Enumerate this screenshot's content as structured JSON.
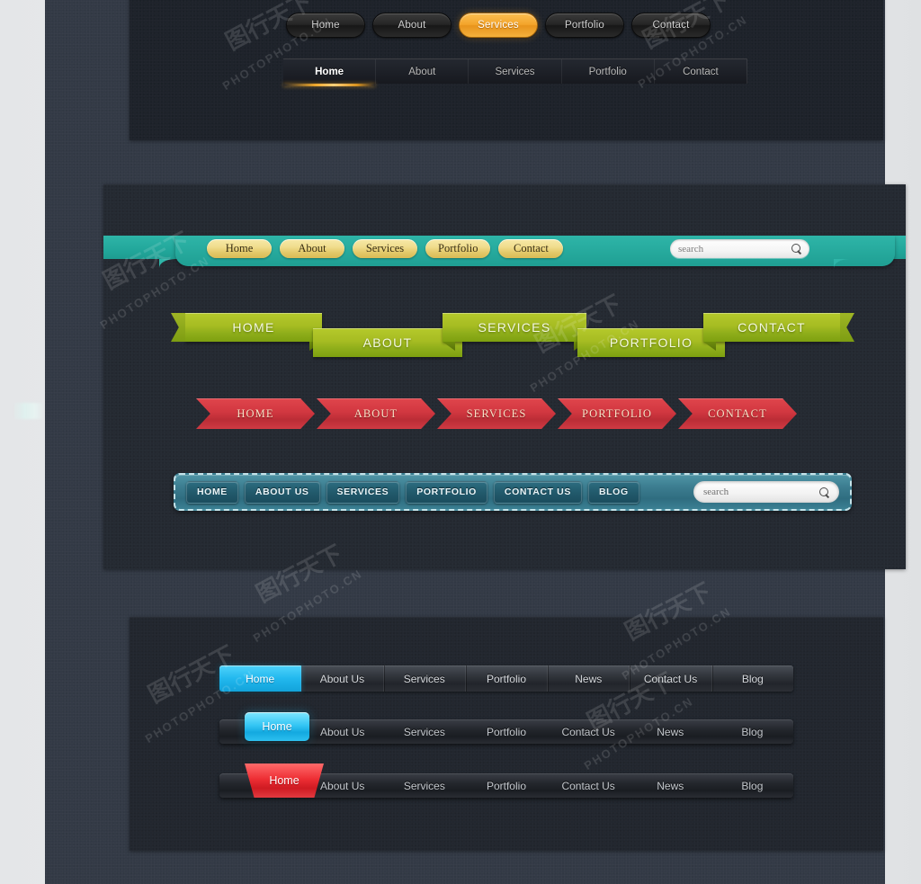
{
  "page": {
    "title": "Web Navigation Menu UI Kit",
    "background_color": "#e8eaec",
    "stage_color": "#333a46",
    "panel_color": "#1e232b"
  },
  "watermark": {
    "text": "PHOTOPHOTO.CN",
    "short": "PHOTO.CN",
    "cn": "图行天下"
  },
  "navs": {
    "pills": {
      "name": "glossy-pill-nav",
      "accent": "#f3a42a",
      "items": [
        {
          "label": "Home",
          "active": false
        },
        {
          "label": "About",
          "active": false
        },
        {
          "label": "Services",
          "active": true
        },
        {
          "label": "Portfolio",
          "active": false
        },
        {
          "label": "Contact",
          "active": false
        }
      ]
    },
    "tabs": {
      "name": "flat-underline-tab-nav",
      "accent": "#f0a82c",
      "items": [
        {
          "label": "Home",
          "active": true
        },
        {
          "label": "About",
          "active": false
        },
        {
          "label": "Services",
          "active": false
        },
        {
          "label": "Portfolio",
          "active": false
        },
        {
          "label": "Contact",
          "active": false
        }
      ]
    },
    "teal": {
      "name": "teal-banner-nav",
      "band_color": "#22a79b",
      "pill_color": "#e8d77f",
      "items": [
        {
          "label": "Home"
        },
        {
          "label": "About"
        },
        {
          "label": "Services"
        },
        {
          "label": "Portfolio"
        },
        {
          "label": "Contact"
        }
      ],
      "search": {
        "placeholder": "search",
        "value": "",
        "icon": "search-icon"
      }
    },
    "green": {
      "name": "green-ribbon-nav",
      "color": "#a6bc22",
      "items": [
        {
          "label": "HOME",
          "level": "up"
        },
        {
          "label": "ABOUT",
          "level": "down"
        },
        {
          "label": "SERVICES",
          "level": "up"
        },
        {
          "label": "PORTFOLIO",
          "level": "down"
        },
        {
          "label": "CONTACT",
          "level": "up"
        }
      ]
    },
    "red": {
      "name": "red-arrow-ribbon-nav",
      "color": "#d13740",
      "items": [
        {
          "label": "HOME"
        },
        {
          "label": "ABOUT"
        },
        {
          "label": "SERVICES"
        },
        {
          "label": "PORTFOLIO"
        },
        {
          "label": "CONTACT"
        }
      ]
    },
    "blue": {
      "name": "stitched-blue-nav",
      "color": "#3c7d90",
      "items": [
        {
          "label": "HOME"
        },
        {
          "label": "ABOUT US"
        },
        {
          "label": "SERVICES"
        },
        {
          "label": "PORTFOLIO"
        },
        {
          "label": "CONTACT US"
        },
        {
          "label": "BLOG"
        }
      ],
      "search": {
        "placeholder": "search",
        "value": "",
        "icon": "search-icon"
      }
    },
    "dark_cyan_flat": {
      "name": "dark-bar-cyan-active-nav",
      "accent": "#22b8ee",
      "items": [
        {
          "label": "Home",
          "active": true
        },
        {
          "label": "About Us",
          "active": false
        },
        {
          "label": "Services",
          "active": false
        },
        {
          "label": "Portfolio",
          "active": false
        },
        {
          "label": "News",
          "active": false
        },
        {
          "label": "Contact Us",
          "active": false
        },
        {
          "label": "Blog",
          "active": false
        }
      ]
    },
    "dark_cyan_raised": {
      "name": "dark-bar-raised-cyan-tab-nav",
      "accent": "#35c6f4",
      "active_label": "Home",
      "items": [
        {
          "label": "About Us"
        },
        {
          "label": "Services"
        },
        {
          "label": "Portfolio"
        },
        {
          "label": "Contact Us"
        },
        {
          "label": "News"
        },
        {
          "label": "Blog"
        }
      ]
    },
    "dark_red_raised": {
      "name": "dark-bar-raised-red-tab-nav",
      "accent": "#ee2f35",
      "active_label": "Home",
      "items": [
        {
          "label": "About Us"
        },
        {
          "label": "Services"
        },
        {
          "label": "Portfolio"
        },
        {
          "label": "Contact Us"
        },
        {
          "label": "News"
        },
        {
          "label": "Blog"
        }
      ]
    }
  }
}
